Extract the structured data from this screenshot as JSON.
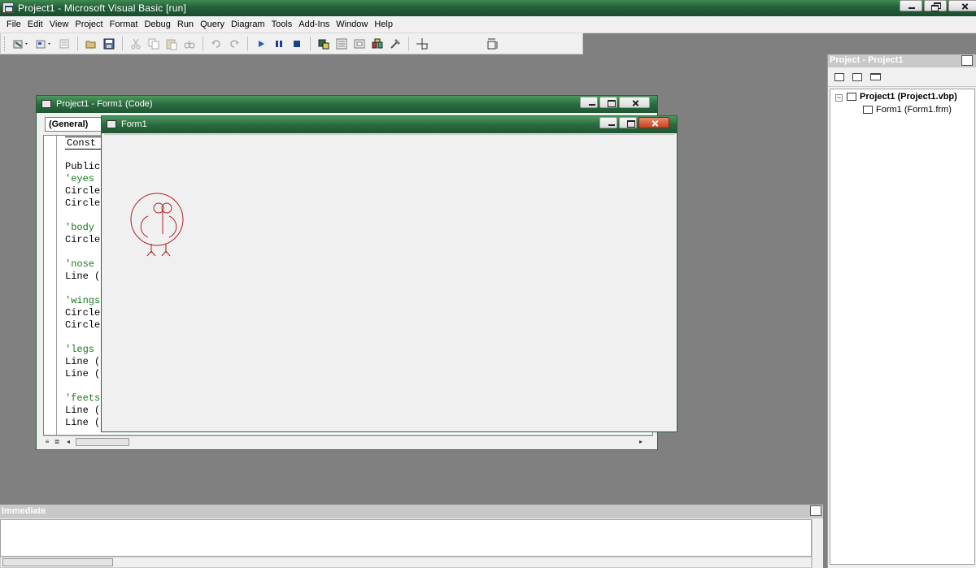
{
  "app": {
    "title": "Project1 - Microsoft Visual Basic [run]"
  },
  "menu": {
    "items": [
      {
        "label": "File"
      },
      {
        "label": "Edit"
      },
      {
        "label": "View"
      },
      {
        "label": "Project"
      },
      {
        "label": "Format"
      },
      {
        "label": "Debug"
      },
      {
        "label": "Run"
      },
      {
        "label": "Query"
      },
      {
        "label": "Diagram"
      },
      {
        "label": "Tools"
      },
      {
        "label": "Add-Ins"
      },
      {
        "label": "Window"
      },
      {
        "label": "Help"
      }
    ]
  },
  "toolbar": {
    "icons": [
      "add-project-icon",
      "add-form-icon",
      "menu-editor-icon",
      "open-icon",
      "save-icon",
      "cut-icon",
      "copy-icon",
      "paste-icon",
      "find-icon",
      "undo-icon",
      "redo-icon",
      "start-icon",
      "break-icon",
      "end-icon",
      "project-explorer-icon",
      "properties-icon",
      "form-layout-icon",
      "object-browser-icon",
      "toolbox-icon",
      "position-icon",
      "size-icon"
    ]
  },
  "code_window": {
    "title": "Project1 - Form1 (Code)",
    "object_combo": "(General)",
    "lines": [
      {
        "text": "Const",
        "type": "code"
      },
      {
        "text": "Public",
        "type": "code"
      },
      {
        "text": "'eyes",
        "type": "comment"
      },
      {
        "text": "Circle",
        "type": "code"
      },
      {
        "text": "Circle",
        "type": "code"
      },
      {
        "text": "'body",
        "type": "comment"
      },
      {
        "text": "Circle",
        "type": "code"
      },
      {
        "text": "'nose",
        "type": "comment"
      },
      {
        "text": "Line (",
        "type": "code"
      },
      {
        "text": "'wings",
        "type": "comment"
      },
      {
        "text": "Circle",
        "type": "code"
      },
      {
        "text": "Circle",
        "type": "code"
      },
      {
        "text": "'legs",
        "type": "comment"
      },
      {
        "text": "Line (",
        "type": "code"
      },
      {
        "text": "Line (",
        "type": "code"
      },
      {
        "text": "'feets",
        "type": "comment"
      },
      {
        "text": "Line (",
        "type": "code"
      },
      {
        "text": "Line (",
        "type": "code"
      }
    ]
  },
  "form_window": {
    "title": "Form1",
    "drawing": "bird-drawing",
    "drawing_color": "#b02020"
  },
  "project_explorer": {
    "title": "Project - Project1",
    "project_node": "Project1 (Project1.vbp)",
    "form_node": "Form1 (Form1.frm)"
  },
  "immediate": {
    "title": "Immediate"
  },
  "colors": {
    "title_green": "#23603a",
    "mdi_background": "#808080",
    "comment_green": "#1a7a1a"
  }
}
